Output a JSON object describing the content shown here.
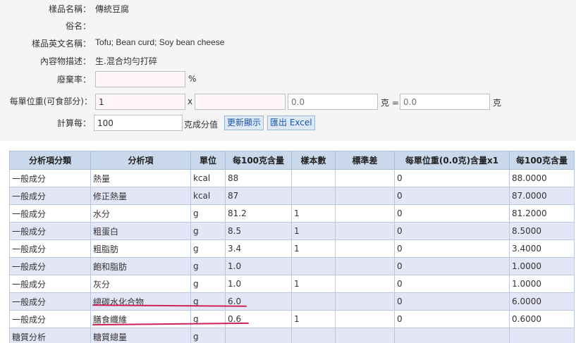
{
  "info": {
    "sample_name_label": "樣品名稱：",
    "sample_name": "傳統豆腐",
    "common_name_label": "俗名：",
    "common_name": "",
    "english_name_label": "樣品英文名稱：",
    "english_name": "Tofu; Bean curd; Soy bean cheese",
    "content_desc_label": "內容物描述：",
    "content_desc": "生.混合均勻打碎",
    "waste_rate_label": "廢棄率：",
    "waste_rate_value": "",
    "waste_rate_unit": "%",
    "unit_weight_label": "每單位重(可食部分)：",
    "unit_count": "1",
    "times": "x",
    "unit_weight": "",
    "unit_total_placeholder": "0.0",
    "gram_eq": "克 =",
    "unit_result_placeholder": "0.0",
    "gram": "克",
    "calc_label": "計算每：",
    "calc_value": "100",
    "calc_unit": "克成分值",
    "refresh_button": "更新顯示",
    "export_button": "匯出 Excel"
  },
  "table": {
    "headers": [
      "分析項分類",
      "分析項",
      "單位",
      "每100克含量",
      "樣本數",
      "標準差",
      "每單位重(0.0克)含量x1",
      "每100克含量"
    ],
    "rows": [
      {
        "category": "一般成分",
        "item": "熱量",
        "unit": "kcal",
        "per100": "88",
        "samples": "",
        "sd": "",
        "per_unit": "0",
        "calc": "88.0000"
      },
      {
        "category": "一般成分",
        "item": "修正熱量",
        "unit": "kcal",
        "per100": "87",
        "samples": "",
        "sd": "",
        "per_unit": "0",
        "calc": "87.0000"
      },
      {
        "category": "一般成分",
        "item": "水分",
        "unit": "g",
        "per100": "81.2",
        "samples": "1",
        "sd": "",
        "per_unit": "0",
        "calc": "81.2000"
      },
      {
        "category": "一般成分",
        "item": "粗蛋白",
        "unit": "g",
        "per100": "8.5",
        "samples": "1",
        "sd": "",
        "per_unit": "0",
        "calc": "8.5000"
      },
      {
        "category": "一般成分",
        "item": "粗脂肪",
        "unit": "g",
        "per100": "3.4",
        "samples": "1",
        "sd": "",
        "per_unit": "0",
        "calc": "3.4000"
      },
      {
        "category": "一般成分",
        "item": "飽和脂肪",
        "unit": "g",
        "per100": "1.0",
        "samples": "",
        "sd": "",
        "per_unit": "0",
        "calc": "1.0000"
      },
      {
        "category": "一般成分",
        "item": "灰分",
        "unit": "g",
        "per100": "1.0",
        "samples": "1",
        "sd": "",
        "per_unit": "0",
        "calc": "1.0000"
      },
      {
        "category": "一般成分",
        "item": "總碳水化合物",
        "unit": "g",
        "per100": "6.0",
        "samples": "",
        "sd": "",
        "per_unit": "0",
        "calc": "6.0000"
      },
      {
        "category": "一般成分",
        "item": "膳食纖維",
        "unit": "g",
        "per100": "0.6",
        "samples": "1",
        "sd": "",
        "per_unit": "0",
        "calc": "0.6000"
      },
      {
        "category": "糖質分析",
        "item": "糖質總量",
        "unit": "g",
        "per100": "",
        "samples": "",
        "sd": "",
        "per_unit": "",
        "calc": ""
      }
    ]
  },
  "colors": {
    "header_bg": "#c9d8ea",
    "row_alt_bg": "#e4e6f8",
    "annotation": "#cc2255",
    "button_text": "#1a56a8"
  }
}
